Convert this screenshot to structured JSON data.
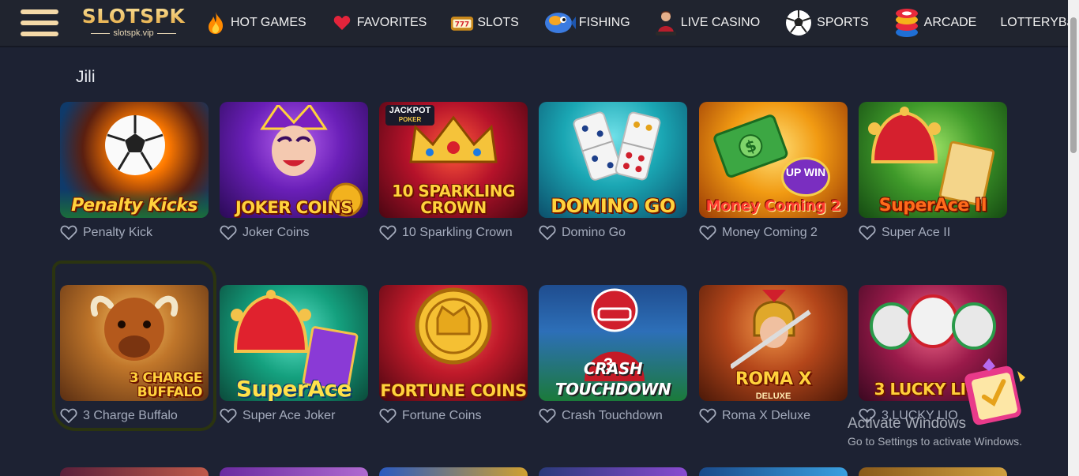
{
  "header": {
    "logo_main": "SLOTSPK",
    "logo_sub": "slotspk.vip",
    "nav": [
      {
        "label": "HOT GAMES",
        "icon": "flame-icon"
      },
      {
        "label": "FAVORITES",
        "icon": "heart-icon"
      },
      {
        "label": "SLOTS",
        "icon": "slot-machine-icon"
      },
      {
        "label": "FISHING",
        "icon": "fish-icon"
      },
      {
        "label": "LIVE CASINO",
        "icon": "dealer-icon"
      },
      {
        "label": "SPORTS",
        "icon": "soccer-ball-icon"
      },
      {
        "label": "ARCADE",
        "icon": "chips-icon"
      },
      {
        "label": "LOTTERYBa",
        "icon": ""
      }
    ]
  },
  "section": {
    "title": "Jili"
  },
  "games": [
    {
      "name": "Penalty Kick",
      "art_title": "Penalty Kicks"
    },
    {
      "name": "Joker Coins",
      "art_title": "JOKER COINS"
    },
    {
      "name": "10 Sparkling Crown",
      "art_title": "10 SPARKLING CROWN"
    },
    {
      "name": "Domino Go",
      "art_title": "DOMINO GO"
    },
    {
      "name": "Money Coming 2",
      "art_title": "Money Coming 2"
    },
    {
      "name": "Super Ace II",
      "art_title": "SuperAce II"
    },
    {
      "name": "3 Charge Buffalo",
      "art_title": "3 CHARGE BUFFALO"
    },
    {
      "name": "Super Ace Joker",
      "art_title": "SuperAce"
    },
    {
      "name": "Fortune Coins",
      "art_title": "FORTUNE COINS"
    },
    {
      "name": "Crash Touchdown",
      "art_title": "CRASH TOUCHDOWN"
    },
    {
      "name": "Roma X Deluxe",
      "art_title": "ROMA X"
    },
    {
      "name": "3 LUCKY LIO",
      "art_title": "3 LUCKY LION"
    }
  ],
  "art_labels": {
    "jackpot": "JACKPOT",
    "jackpot_sub": "POKER",
    "up_win": "UP WIN",
    "jersey_number": "3",
    "deluxe": "DELUXE"
  },
  "watermark": {
    "title": "Activate Windows",
    "subtitle": "Go to Settings to activate Windows."
  },
  "colors": {
    "background": "#1d2233",
    "header": "#20242f",
    "logo_gold": "#f4d9a8",
    "label_text": "#a5acbd"
  }
}
